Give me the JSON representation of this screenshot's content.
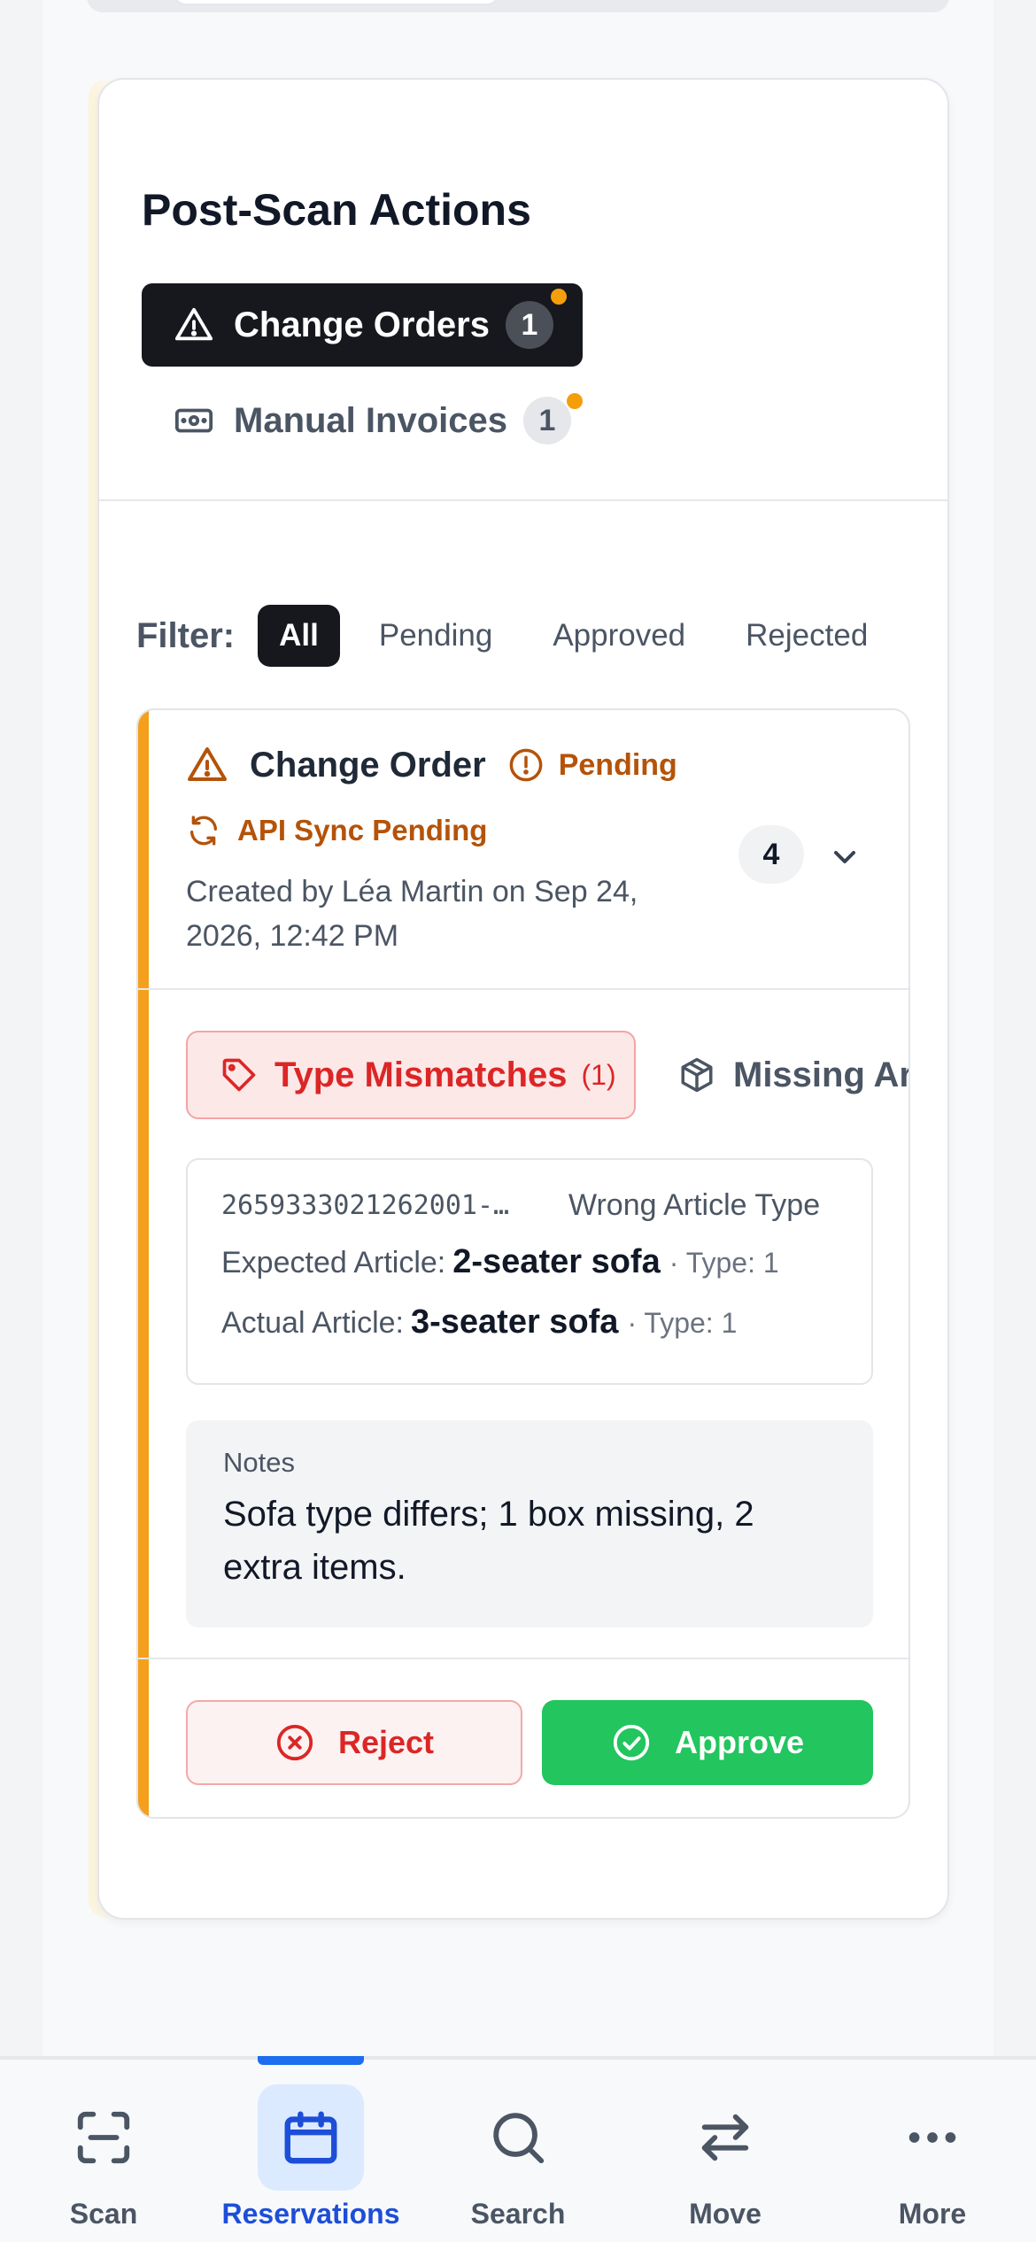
{
  "card": {
    "title": "Post-Scan Actions",
    "tabs": [
      {
        "label": "Change Orders",
        "count": "1",
        "icon": "warning-triangle-icon"
      },
      {
        "label": "Manual Invoices",
        "count": "1",
        "icon": "cash-icon"
      }
    ]
  },
  "filter": {
    "label": "Filter:",
    "options": [
      "All",
      "Pending",
      "Approved",
      "Rejected"
    ],
    "selected": "All"
  },
  "change_order": {
    "title": "Change Order",
    "status": "Pending",
    "sync_status": "API Sync Pending",
    "created": "Created by Léa Martin on Sep 24, 2026, 12:42 PM",
    "item_count": "4",
    "issue_tabs": [
      {
        "label": "Type Mismatches",
        "count": "(1)",
        "icon": "tag-icon"
      },
      {
        "label": "Missing Articles",
        "icon": "box-icon"
      }
    ],
    "mismatch": {
      "barcode": "2659333021262001-…",
      "issue": "Wrong Article Type",
      "expected_label": "Expected Article:",
      "expected_article": "2-seater sofa",
      "expected_type": "· Type: 1",
      "actual_label": "Actual Article:",
      "actual_article": "3-seater sofa",
      "actual_type": "· Type: 1"
    },
    "notes_label": "Notes",
    "notes": "Sofa type differs; 1 box missing, 2 extra items.",
    "reject_label": "Reject",
    "approve_label": "Approve"
  },
  "nav": {
    "items": [
      {
        "label": "Scan",
        "icon": "scan-icon"
      },
      {
        "label": "Reservations",
        "icon": "calendar-icon"
      },
      {
        "label": "Search",
        "icon": "search-icon"
      },
      {
        "label": "Move",
        "icon": "swap-arrows-icon"
      },
      {
        "label": "More",
        "icon": "more-dots-icon"
      }
    ],
    "active": "Reservations"
  },
  "colors": {
    "accent_blue": "#1d4ed8",
    "pending_orange": "#b45309",
    "order_bar": "#f4a01c",
    "reject_red": "#dc2626",
    "approve_green": "#22c55e"
  }
}
